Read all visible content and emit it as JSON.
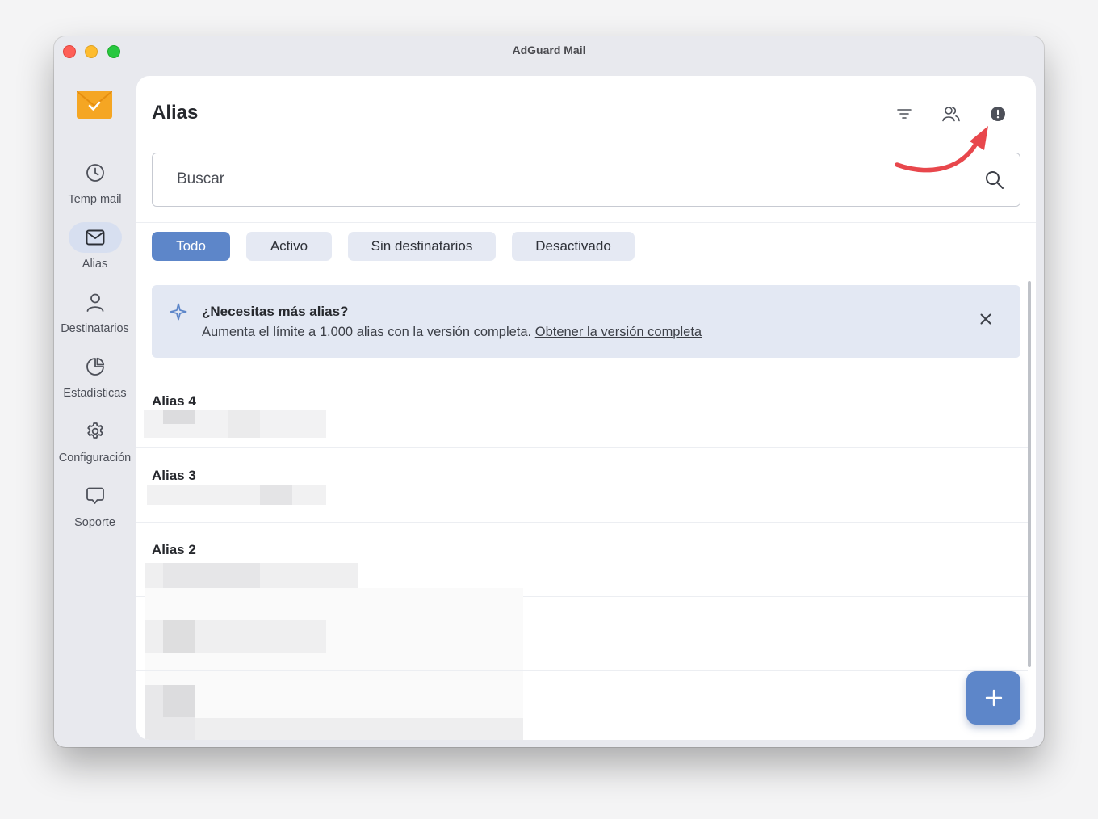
{
  "window": {
    "title": "AdGuard Mail"
  },
  "sidebar": {
    "items": [
      {
        "label": "Temp mail",
        "icon": "clock-icon",
        "active": false
      },
      {
        "label": "Alias",
        "icon": "envelope-icon",
        "active": true
      },
      {
        "label": "Destinatarios",
        "icon": "person-icon",
        "active": false
      },
      {
        "label": "Estadísticas",
        "icon": "pie-chart-icon",
        "active": false
      },
      {
        "label": "Configuración",
        "icon": "gear-icon",
        "active": false
      },
      {
        "label": "Soporte",
        "icon": "chat-bubble-icon",
        "active": false
      }
    ]
  },
  "header": {
    "title": "Alias",
    "icons": [
      "filter-icon",
      "users-icon",
      "info-icon"
    ]
  },
  "search": {
    "placeholder": "Buscar"
  },
  "filters": {
    "chips": [
      "Todo",
      "Activo",
      "Sin destinatarios",
      "Desactivado"
    ],
    "selected": "Todo"
  },
  "banner": {
    "title": "¿Necesitas más alias?",
    "text": "Aumenta el límite a 1.000 alias con la versión completa.",
    "link": "Obtener la versión completa"
  },
  "aliases": [
    {
      "name": "Alias 4"
    },
    {
      "name": "Alias 3"
    },
    {
      "name": "Alias 2"
    }
  ],
  "colors": {
    "accent": "#5d86c9",
    "banner_bg": "#e3e8f3",
    "logo": "#f5a623",
    "annotation_arrow": "#e8474c"
  }
}
